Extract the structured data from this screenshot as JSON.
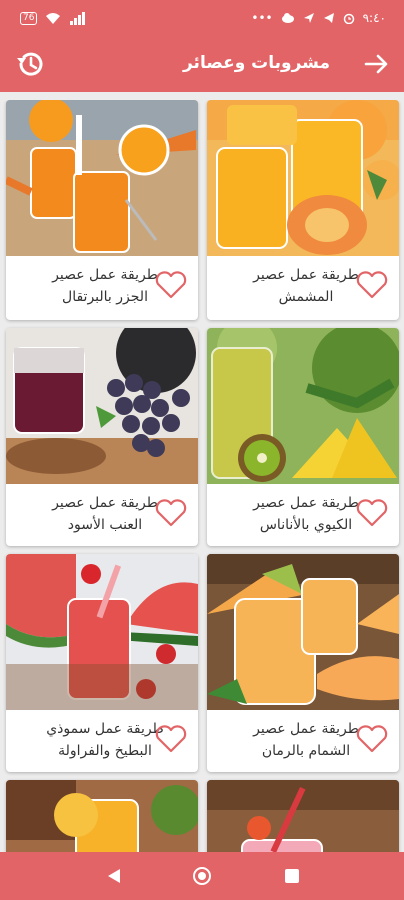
{
  "status": {
    "time": "٩:٤٠",
    "battery": "76",
    "battery_icon": "battery-icon",
    "wifi_icon": "wifi-icon",
    "signal_icon": "signal-icon"
  },
  "app_bar": {
    "title": "مشروبات وعصائر",
    "back_icon": "arrow-right-icon",
    "history_icon": "history-icon"
  },
  "recipes": [
    {
      "line1": "طريقة عمل عصير",
      "line2": "المشمش"
    },
    {
      "line1": "طريقة عمل عصير",
      "line2": "الجزر بالبرتقال"
    },
    {
      "line1": "طريقة عمل عصير",
      "line2": "الكيوي بالأناناس"
    },
    {
      "line1": "طريقة عمل عصير",
      "line2": "العنب الأسود"
    },
    {
      "line1": "طريقة عمل عصير",
      "line2": "الشمام بالرمان"
    },
    {
      "line1": "طريقة عمل سموذي",
      "line2": "البطيخ والفراولة"
    }
  ],
  "colors": {
    "accent": "#e26466",
    "heart": "#e26466"
  },
  "nav": {
    "back_icon": "triangle-back-icon",
    "home_icon": "circle-home-icon",
    "recents_icon": "square-recents-icon"
  }
}
